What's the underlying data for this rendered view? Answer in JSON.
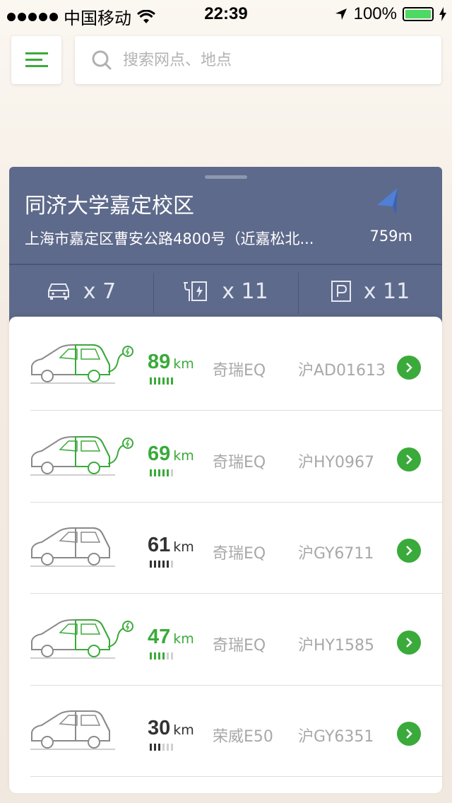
{
  "status": {
    "carrier": "中国移动",
    "time": "22:39",
    "battery": "100%",
    "battery_level": 1.0
  },
  "search": {
    "placeholder": "搜索网点、地点"
  },
  "station": {
    "name": "同济大学嘉定校区",
    "address": "上海市嘉定区曹安公路4800号（近嘉松北...",
    "distance": "759m",
    "stats": [
      {
        "icon": "car-icon",
        "count": "x 7"
      },
      {
        "icon": "charger-icon",
        "count": "x 11"
      },
      {
        "icon": "parking-icon",
        "count": "x 11"
      }
    ]
  },
  "colors": {
    "accent_green": "#3aaa3a",
    "panel_blue": "#5e6a8b",
    "range_dark": "#333333"
  },
  "cars": [
    {
      "range": "89",
      "unit": "km",
      "model": "奇瑞EQ",
      "plate": "沪AD01613",
      "charging": true,
      "battery_level": 1.0
    },
    {
      "range": "69",
      "unit": "km",
      "model": "奇瑞EQ",
      "plate": "沪HY0967",
      "charging": true,
      "battery_level": 0.83
    },
    {
      "range": "61",
      "unit": "km",
      "model": "奇瑞EQ",
      "plate": "沪GY6711",
      "charging": false,
      "battery_level": 0.83
    },
    {
      "range": "47",
      "unit": "km",
      "model": "奇瑞EQ",
      "plate": "沪HY1585",
      "charging": true,
      "battery_level": 0.67
    },
    {
      "range": "30",
      "unit": "km",
      "model": "荣威E50",
      "plate": "沪GY6351",
      "charging": false,
      "battery_level": 0.5
    }
  ]
}
